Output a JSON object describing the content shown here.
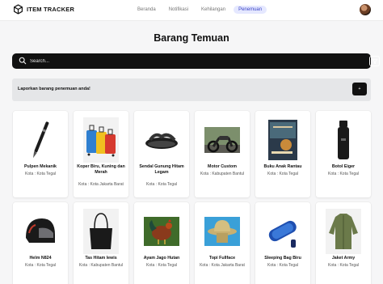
{
  "brand": {
    "name": "ITEM TRACKER",
    "icon": "box-logo-icon"
  },
  "nav": {
    "items": [
      {
        "label": "Beranda",
        "active": false
      },
      {
        "label": "Notifikasi",
        "active": false
      },
      {
        "label": "Kehilangan",
        "active": false
      },
      {
        "label": "Penemuan",
        "active": true
      }
    ],
    "avatar": "user-avatar"
  },
  "page": {
    "title": "Barang Temuan"
  },
  "search": {
    "placeholder": "Search...",
    "value": "",
    "icon": "search-icon",
    "filter_icon": "filter-icon"
  },
  "report": {
    "text": "Laporkan barang penemuan anda!",
    "button": "+"
  },
  "colors": {
    "accent": "#3b45c7",
    "accent_bg": "#e5e8ff",
    "dark": "#111111"
  },
  "items": [
    {
      "name": "Pulpen Mekanik",
      "city": "Kota : Kota Tegal",
      "icon": "pen-icon"
    },
    {
      "name": "Koper Biru, Kuning dan Merah",
      "city": "Kota : Kota Jakarta Barat",
      "icon": "suitcase-icon"
    },
    {
      "name": "Sendal Gunung Hitam Legam",
      "city": "Kota : Kota Tegal",
      "icon": "sandal-icon"
    },
    {
      "name": "Motor Custom",
      "city": "Kota : Kabupaten Bantul",
      "icon": "motorcycle-icon"
    },
    {
      "name": "Buku Anak Rantau",
      "city": "Kota : Kota Tegal",
      "icon": "book-icon"
    },
    {
      "name": "Botol Eiger",
      "city": "Kota : Kota Tegal",
      "icon": "bottle-icon"
    },
    {
      "name": "Helm N824",
      "city": "Kota : Kota Tegal",
      "icon": "helmet-icon"
    },
    {
      "name": "Tas Hitam lewis",
      "city": "Kota : Kabupaten Bantul",
      "icon": "bag-icon"
    },
    {
      "name": "Ayam Jago Hutan",
      "city": "Kota : Kota Tegal",
      "icon": "rooster-icon"
    },
    {
      "name": "Topi Fullface",
      "city": "Kota : Kota Jakarta Barat",
      "icon": "hat-icon"
    },
    {
      "name": "Sleeping Bag Biru",
      "city": "Kota : Kota Tegal",
      "icon": "sleeping-bag-icon"
    },
    {
      "name": "Jaket Army",
      "city": "Kota : Kota Tegal",
      "icon": "jacket-icon"
    }
  ]
}
